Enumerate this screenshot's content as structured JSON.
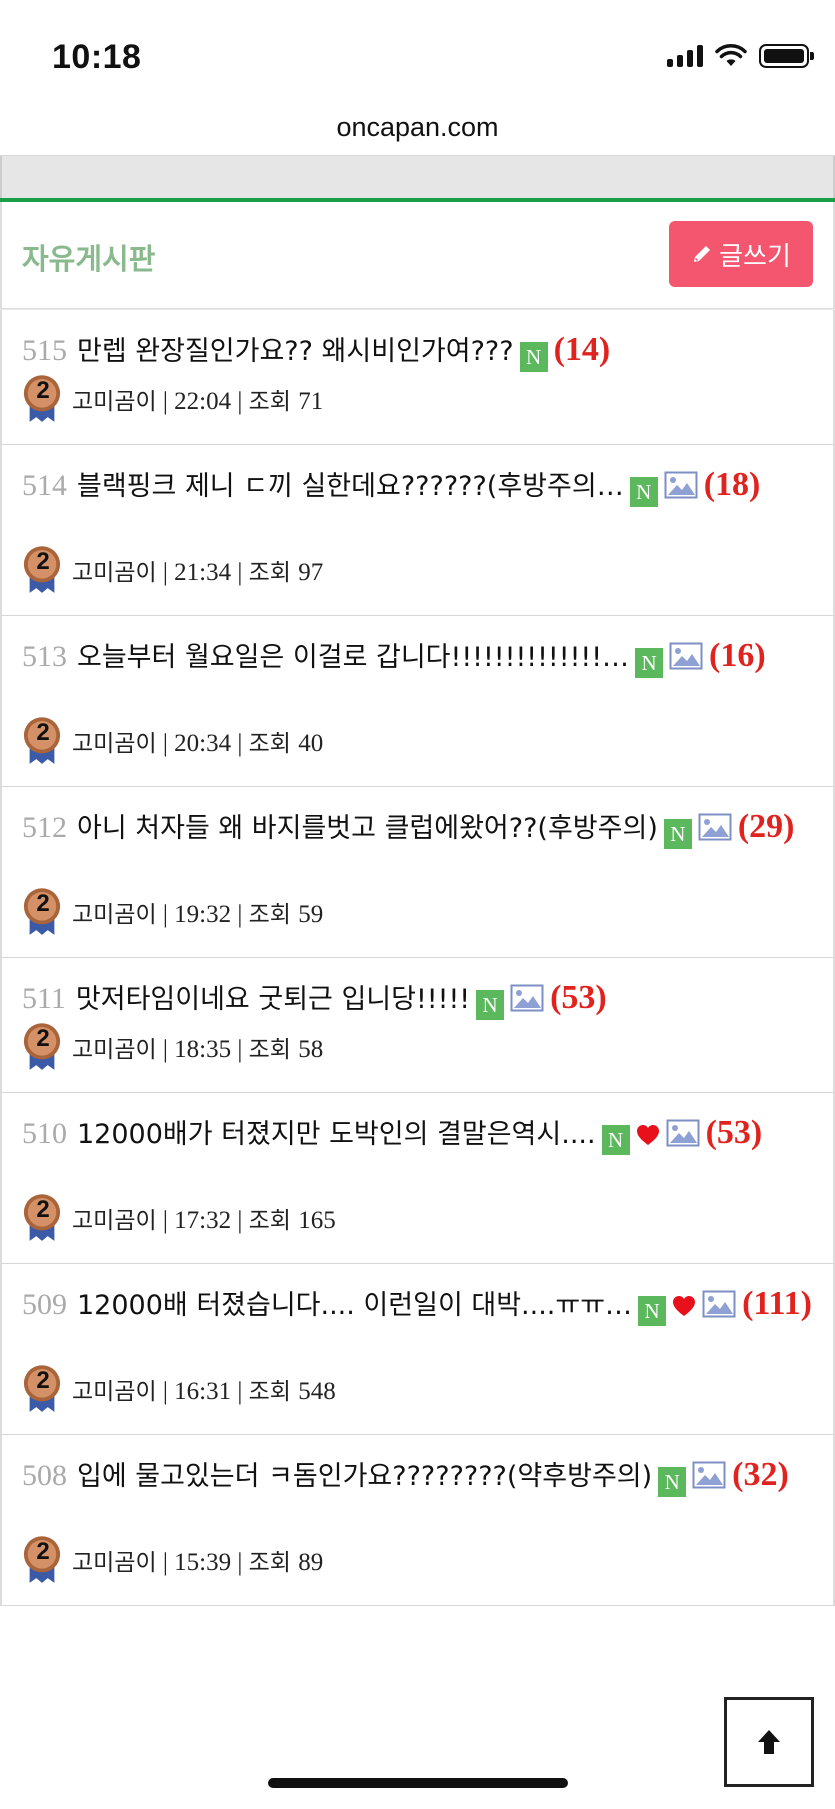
{
  "status_bar": {
    "time": "10:18"
  },
  "browser": {
    "url": "oncapan.com"
  },
  "board": {
    "title": "자유게시판",
    "write_label": "글쓰기"
  },
  "colors": {
    "accent_green": "#1b9e4b",
    "write_button": "#f4566f",
    "comment_count": "#e0231f",
    "new_badge": "#5cb85c"
  },
  "posts": [
    {
      "num": "515",
      "title": "만렙 완장질인가요?? 왜시비인가여???",
      "new": true,
      "heart": false,
      "image": false,
      "comments": "(14)",
      "author": "고미곰이",
      "time": "22:04",
      "views_label": "조회",
      "views": "71"
    },
    {
      "num": "514",
      "title": "블랙핑크 제니 ㄷ끼 실한데요??????(후방주의…",
      "new": true,
      "heart": false,
      "image": true,
      "comments": "(18)",
      "author": "고미곰이",
      "time": "21:34",
      "views_label": "조회",
      "views": "97"
    },
    {
      "num": "513",
      "title": "오늘부터 월요일은 이걸로 갑니다!!!!!!!!!!!!!!…",
      "new": true,
      "heart": false,
      "image": true,
      "comments": "(16)",
      "author": "고미곰이",
      "time": "20:34",
      "views_label": "조회",
      "views": "40"
    },
    {
      "num": "512",
      "title": "아니 처자들 왜 바지를벗고 클럽에왔어??(후방주의)",
      "new": true,
      "heart": false,
      "image": true,
      "comments": "(29)",
      "author": "고미곰이",
      "time": "19:32",
      "views_label": "조회",
      "views": "59"
    },
    {
      "num": "511",
      "title": "맛저타임이네요 굿퇴근 입니당!!!!!",
      "new": true,
      "heart": false,
      "image": true,
      "comments": "(53)",
      "author": "고미곰이",
      "time": "18:35",
      "views_label": "조회",
      "views": "58"
    },
    {
      "num": "510",
      "title": "12000배가 터졌지만 도박인의 결말은역시....",
      "new": true,
      "heart": true,
      "image": true,
      "comments": "(53)",
      "author": "고미곰이",
      "time": "17:32",
      "views_label": "조회",
      "views": "165"
    },
    {
      "num": "509",
      "title": "12000배 터졌습니다.... 이런일이 대박....ㅠㅠ…",
      "new": true,
      "heart": true,
      "image": true,
      "comments": "(111)",
      "author": "고미곰이",
      "time": "16:31",
      "views_label": "조회",
      "views": "548"
    },
    {
      "num": "508",
      "title": "입에 물고있는더 ㅋ돔인가요????????(약후방주의)",
      "new": true,
      "heart": false,
      "image": true,
      "comments": "(32)",
      "author": "고미곰이",
      "time": "15:39",
      "views_label": "조회",
      "views": "89"
    }
  ],
  "badges": {
    "new_label": "N",
    "avatar_level": "2"
  }
}
